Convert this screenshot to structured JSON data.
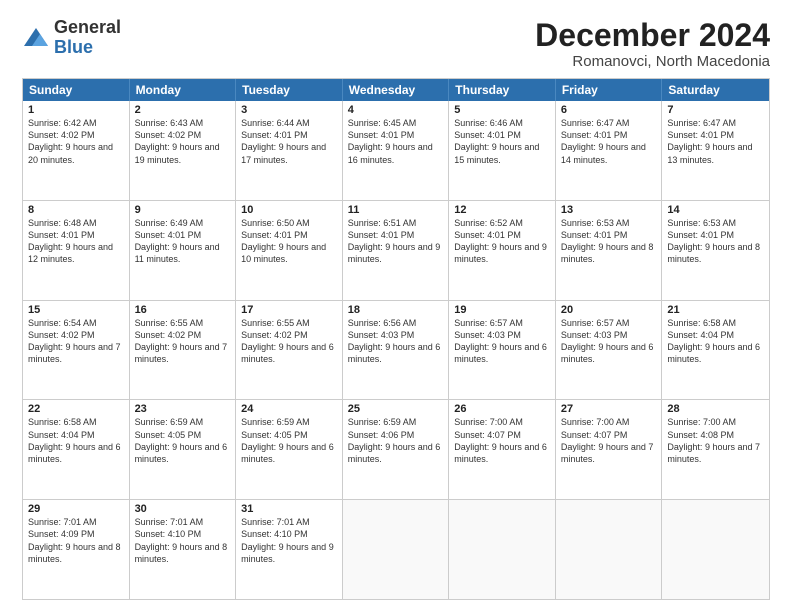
{
  "header": {
    "logo": {
      "general": "General",
      "blue": "Blue"
    },
    "title": "December 2024",
    "subtitle": "Romanovci, North Macedonia"
  },
  "calendar": {
    "days": [
      "Sunday",
      "Monday",
      "Tuesday",
      "Wednesday",
      "Thursday",
      "Friday",
      "Saturday"
    ],
    "weeks": [
      [
        {
          "day": "",
          "empty": true
        },
        {
          "day": "",
          "empty": true
        },
        {
          "day": "",
          "empty": true
        },
        {
          "day": "",
          "empty": true
        },
        {
          "day": "",
          "empty": true
        },
        {
          "day": "",
          "empty": true
        },
        {
          "day": "",
          "empty": true
        }
      ],
      [
        {
          "num": "1",
          "rise": "6:42 AM",
          "set": "4:02 PM",
          "daylight": "9 hours and 20 minutes."
        },
        {
          "num": "2",
          "rise": "6:43 AM",
          "set": "4:02 PM",
          "daylight": "9 hours and 19 minutes."
        },
        {
          "num": "3",
          "rise": "6:44 AM",
          "set": "4:01 PM",
          "daylight": "9 hours and 17 minutes."
        },
        {
          "num": "4",
          "rise": "6:45 AM",
          "set": "4:01 PM",
          "daylight": "9 hours and 16 minutes."
        },
        {
          "num": "5",
          "rise": "6:46 AM",
          "set": "4:01 PM",
          "daylight": "9 hours and 15 minutes."
        },
        {
          "num": "6",
          "rise": "6:47 AM",
          "set": "4:01 PM",
          "daylight": "9 hours and 14 minutes."
        },
        {
          "num": "7",
          "rise": "6:47 AM",
          "set": "4:01 PM",
          "daylight": "9 hours and 13 minutes."
        }
      ],
      [
        {
          "num": "8",
          "rise": "6:48 AM",
          "set": "4:01 PM",
          "daylight": "9 hours and 12 minutes."
        },
        {
          "num": "9",
          "rise": "6:49 AM",
          "set": "4:01 PM",
          "daylight": "9 hours and 11 minutes."
        },
        {
          "num": "10",
          "rise": "6:50 AM",
          "set": "4:01 PM",
          "daylight": "9 hours and 10 minutes."
        },
        {
          "num": "11",
          "rise": "6:51 AM",
          "set": "4:01 PM",
          "daylight": "9 hours and 9 minutes."
        },
        {
          "num": "12",
          "rise": "6:52 AM",
          "set": "4:01 PM",
          "daylight": "9 hours and 9 minutes."
        },
        {
          "num": "13",
          "rise": "6:53 AM",
          "set": "4:01 PM",
          "daylight": "9 hours and 8 minutes."
        },
        {
          "num": "14",
          "rise": "6:53 AM",
          "set": "4:01 PM",
          "daylight": "9 hours and 8 minutes."
        }
      ],
      [
        {
          "num": "15",
          "rise": "6:54 AM",
          "set": "4:02 PM",
          "daylight": "9 hours and 7 minutes."
        },
        {
          "num": "16",
          "rise": "6:55 AM",
          "set": "4:02 PM",
          "daylight": "9 hours and 7 minutes."
        },
        {
          "num": "17",
          "rise": "6:55 AM",
          "set": "4:02 PM",
          "daylight": "9 hours and 6 minutes."
        },
        {
          "num": "18",
          "rise": "6:56 AM",
          "set": "4:03 PM",
          "daylight": "9 hours and 6 minutes."
        },
        {
          "num": "19",
          "rise": "6:57 AM",
          "set": "4:03 PM",
          "daylight": "9 hours and 6 minutes."
        },
        {
          "num": "20",
          "rise": "6:57 AM",
          "set": "4:03 PM",
          "daylight": "9 hours and 6 minutes."
        },
        {
          "num": "21",
          "rise": "6:58 AM",
          "set": "4:04 PM",
          "daylight": "9 hours and 6 minutes."
        }
      ],
      [
        {
          "num": "22",
          "rise": "6:58 AM",
          "set": "4:04 PM",
          "daylight": "9 hours and 6 minutes."
        },
        {
          "num": "23",
          "rise": "6:59 AM",
          "set": "4:05 PM",
          "daylight": "9 hours and 6 minutes."
        },
        {
          "num": "24",
          "rise": "6:59 AM",
          "set": "4:05 PM",
          "daylight": "9 hours and 6 minutes."
        },
        {
          "num": "25",
          "rise": "6:59 AM",
          "set": "4:06 PM",
          "daylight": "9 hours and 6 minutes."
        },
        {
          "num": "26",
          "rise": "7:00 AM",
          "set": "4:07 PM",
          "daylight": "9 hours and 6 minutes."
        },
        {
          "num": "27",
          "rise": "7:00 AM",
          "set": "4:07 PM",
          "daylight": "9 hours and 7 minutes."
        },
        {
          "num": "28",
          "rise": "7:00 AM",
          "set": "4:08 PM",
          "daylight": "9 hours and 7 minutes."
        }
      ],
      [
        {
          "num": "29",
          "rise": "7:01 AM",
          "set": "4:09 PM",
          "daylight": "9 hours and 8 minutes."
        },
        {
          "num": "30",
          "rise": "7:01 AM",
          "set": "4:10 PM",
          "daylight": "9 hours and 8 minutes."
        },
        {
          "num": "31",
          "rise": "7:01 AM",
          "set": "4:10 PM",
          "daylight": "9 hours and 9 minutes."
        },
        {
          "day": "",
          "empty": true
        },
        {
          "day": "",
          "empty": true
        },
        {
          "day": "",
          "empty": true
        },
        {
          "day": "",
          "empty": true
        }
      ]
    ]
  }
}
